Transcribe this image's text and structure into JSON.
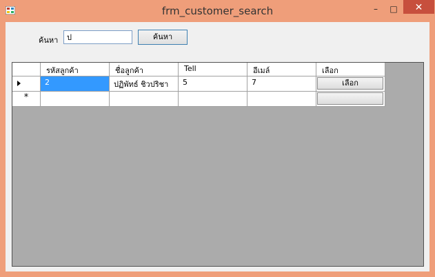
{
  "window": {
    "title": "frm_customer_search",
    "minimize": "–",
    "maximize": "□",
    "close": "✕"
  },
  "search": {
    "label": "ค้นหา",
    "value": "ป",
    "button": "ค้นหา"
  },
  "grid": {
    "columns": [
      "รหัสลูกค้า",
      "ชื่อลูกค้า",
      "Tell",
      "อีเมล์",
      "เลือก"
    ],
    "rows": [
      {
        "id": "2",
        "name": "ปฏิพัทธ์ ชิวปริชา",
        "tell": "5",
        "email": "7",
        "action": "เลือก"
      }
    ],
    "new_row_marker": "*"
  }
}
